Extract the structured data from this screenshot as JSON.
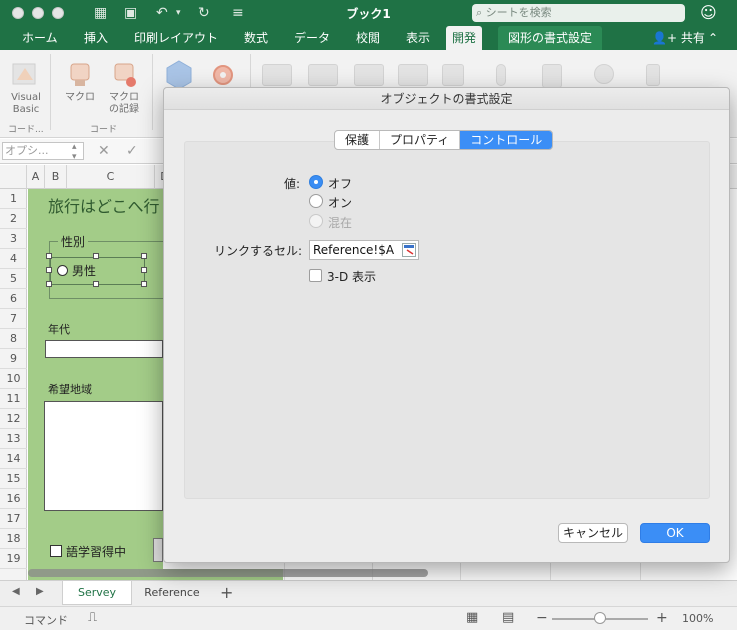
{
  "app": {
    "title": "ブック1",
    "search_placeholder": "シートを検索",
    "accent": "#1f7245"
  },
  "tabs": [
    {
      "label": "ホーム"
    },
    {
      "label": "挿入"
    },
    {
      "label": "印刷レイアウト"
    },
    {
      "label": "数式"
    },
    {
      "label": "データ"
    },
    {
      "label": "校閲"
    },
    {
      "label": "表示"
    },
    {
      "label": "開発",
      "active": true
    },
    {
      "label": "図形の書式設定",
      "context": true
    }
  ],
  "share_label": "共有",
  "ribbon": {
    "vb_label1": "Visual",
    "vb_label2": "Basic",
    "macro_label": "マクロ",
    "record_label1": "マクロ",
    "record_label2": "の記録",
    "group_code": "コード",
    "group_code_short": "コード..."
  },
  "formula": {
    "namebox": "オプシ..."
  },
  "columns": [
    "A",
    "B",
    "C",
    "D"
  ],
  "rows": [
    "1",
    "2",
    "3",
    "4",
    "5",
    "6",
    "7",
    "8",
    "9",
    "10",
    "11",
    "12",
    "13",
    "14",
    "15",
    "16",
    "17",
    "18",
    "19"
  ],
  "sheet": {
    "title_text": "旅行はどこへ行",
    "gender_label": "性別",
    "male_label": "男性",
    "age_label": "年代",
    "region_label": "希望地域",
    "language_label": "語学習得中"
  },
  "sheet_tabs": [
    "Servey",
    "Reference"
  ],
  "status": {
    "mode": "コマンド",
    "zoom": "100%"
  },
  "dialog": {
    "title": "オブジェクトの書式設定",
    "tabs": [
      {
        "label": "保護"
      },
      {
        "label": "プロパティ"
      },
      {
        "label": "コントロール",
        "active": true
      }
    ],
    "value_label": "値:",
    "radios": [
      {
        "label": "オフ",
        "checked": true
      },
      {
        "label": "オン",
        "checked": false
      },
      {
        "label": "混在",
        "disabled": true
      }
    ],
    "link_label": "リンクするセル:",
    "link_value": "Reference!$A",
    "checkbox_3d": "3-D 表示",
    "cancel": "キャンセル",
    "ok": "OK"
  }
}
